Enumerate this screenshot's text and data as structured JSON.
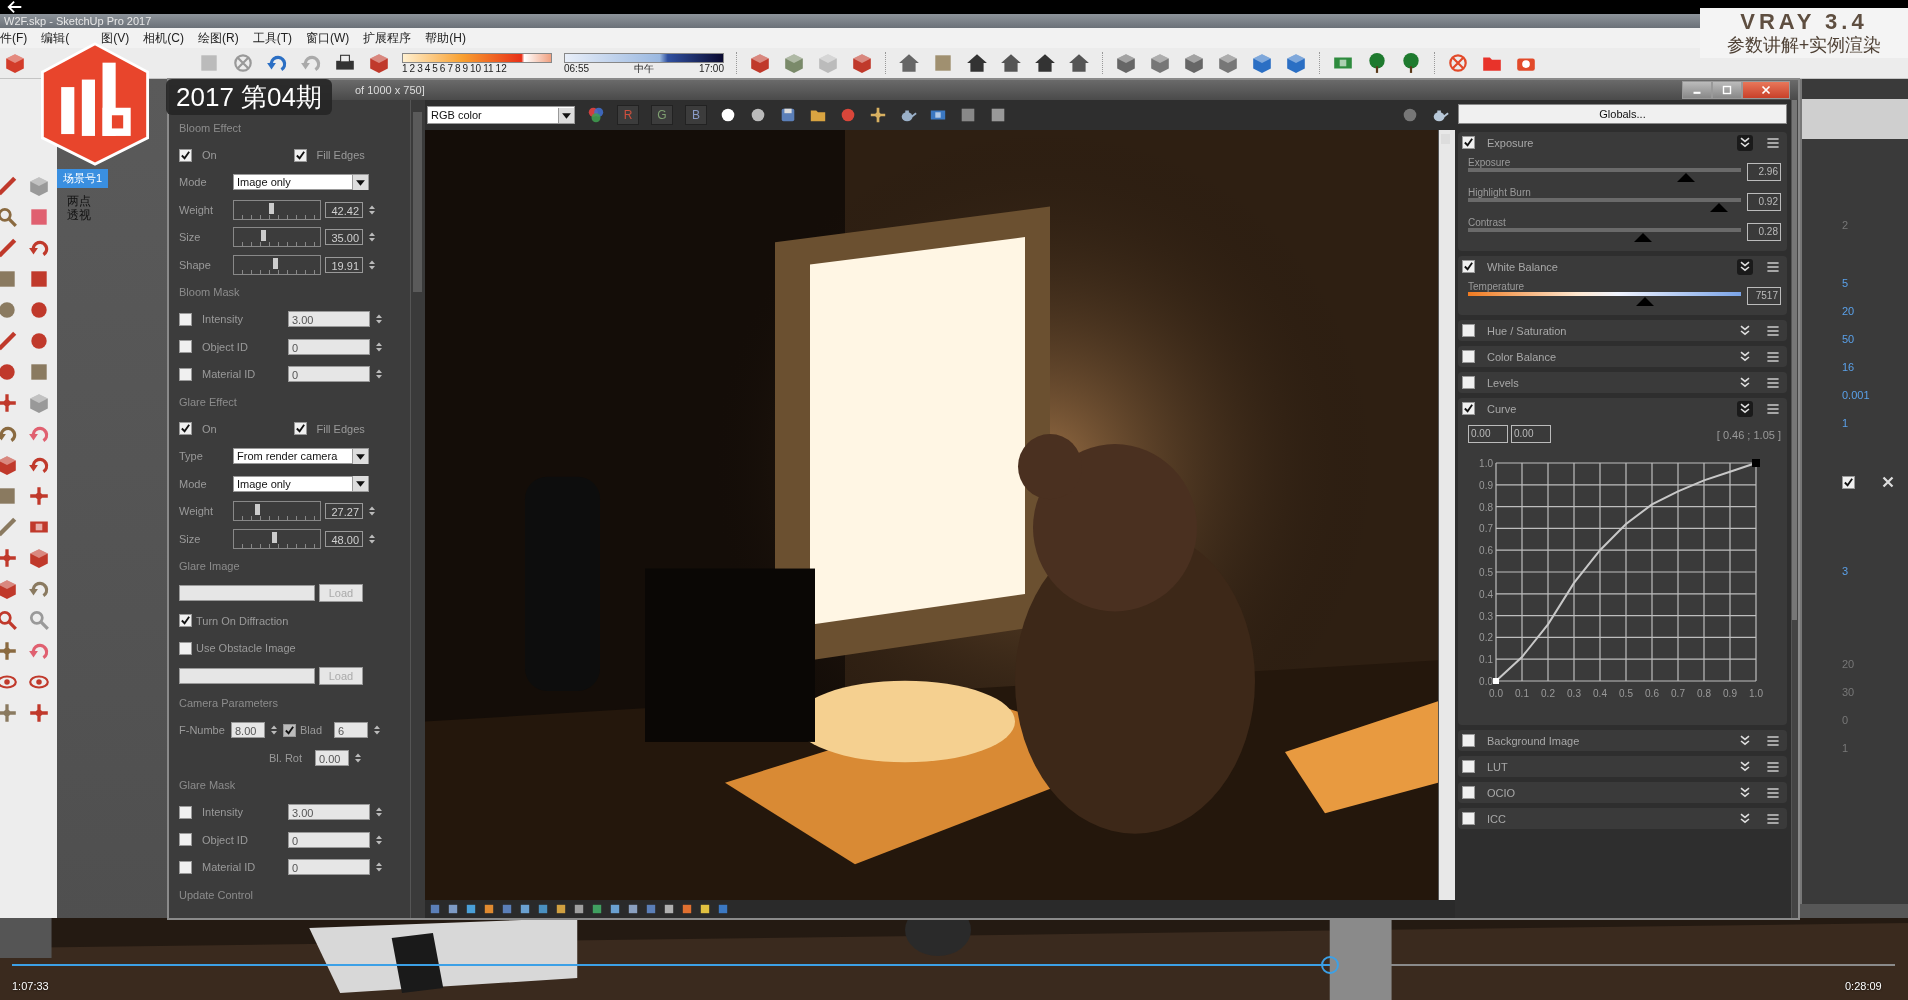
{
  "sketchup": {
    "title": "W2F.skp - SketchUp Pro 2017",
    "menu": [
      "件(F)",
      "编辑(",
      "图(V)",
      "相机(C)",
      "绘图(R)",
      "工具(T)",
      "窗口(W)",
      "扩展程序",
      "帮助(H)"
    ],
    "shadow_months": [
      "1",
      "2",
      "3",
      "4",
      "5",
      "6",
      "7",
      "8",
      "9",
      "10",
      "11",
      "12"
    ],
    "shadow_times": [
      "06:55",
      "中午",
      "17:00"
    ],
    "scene_tab": {
      "label": "场景号1",
      "selected": true
    },
    "viewport_label": "两点透视",
    "tray_groups": [
      [
        {
          "kind": "number",
          "value": "2",
          "disabled": true
        }
      ],
      [
        {
          "kind": "number",
          "value": "5",
          "disabled": false
        },
        {
          "kind": "number",
          "value": "20",
          "disabled": false
        },
        {
          "kind": "number",
          "value": "50",
          "disabled": false
        },
        {
          "kind": "number",
          "value": "16",
          "disabled": false
        },
        {
          "kind": "number",
          "value": "0.001",
          "disabled": false
        },
        {
          "kind": "number",
          "value": "1",
          "disabled": false
        }
      ],
      [
        {
          "kind": "checkbox",
          "checked": true
        }
      ],
      [
        {
          "kind": "number",
          "value": "3",
          "disabled": false
        }
      ],
      [
        {
          "kind": "number",
          "value": "20",
          "disabled": true
        },
        {
          "kind": "number",
          "value": "30",
          "disabled": true
        },
        {
          "kind": "number",
          "value": "0",
          "disabled": true
        },
        {
          "kind": "number",
          "value": "1",
          "disabled": true
        }
      ]
    ]
  },
  "overlays": {
    "badge": "2017 第04期",
    "channel_title": "VRAY 3.4",
    "channel_subtitle": "参数讲解+实例渲染"
  },
  "vfb": {
    "title": "of 1000 x 750]",
    "channel_dropdown": "RGB color",
    "channels": [
      {
        "label": "R",
        "color": "#d0503e",
        "selected": false
      },
      {
        "label": "G",
        "color": "#7fa071",
        "selected": false
      },
      {
        "label": "B",
        "color": "#8a9cc8",
        "selected": false
      }
    ],
    "left_panel": [
      {
        "kind": "header",
        "text": "Bloom Effect"
      },
      {
        "kind": "checks",
        "items": [
          {
            "label": "On",
            "checked": true
          },
          {
            "label": "Fill Edges",
            "checked": true
          }
        ]
      },
      {
        "kind": "dropdown",
        "label": "Mode",
        "value": "Image only"
      },
      {
        "kind": "slider",
        "label": "Weight",
        "level": 0.44,
        "value": "42.42"
      },
      {
        "kind": "slider",
        "label": "Size",
        "level": 0.35,
        "value": "35.00"
      },
      {
        "kind": "slider",
        "label": "Shape",
        "level": 0.49,
        "value": "19.91"
      },
      {
        "kind": "header",
        "text": "Bloom Mask"
      },
      {
        "kind": "check_field",
        "label": "Intensity",
        "checked": false,
        "value": "3.00"
      },
      {
        "kind": "check_field",
        "label": "Object ID",
        "checked": false,
        "value": "0"
      },
      {
        "kind": "check_field",
        "label": "Material ID",
        "checked": false,
        "value": "0"
      },
      {
        "kind": "header",
        "text": "Glare Effect"
      },
      {
        "kind": "checks",
        "items": [
          {
            "label": "On",
            "checked": true
          },
          {
            "label": "Fill Edges",
            "checked": true
          }
        ]
      },
      {
        "kind": "dropdown",
        "label": "Type",
        "value": "From render camera"
      },
      {
        "kind": "dropdown",
        "label": "Mode",
        "value": "Image only"
      },
      {
        "kind": "slider",
        "label": "Weight",
        "level": 0.28,
        "value": "27.27"
      },
      {
        "kind": "slider",
        "label": "Size",
        "level": 0.48,
        "value": "48.00"
      },
      {
        "kind": "header",
        "text": "Glare Image"
      },
      {
        "kind": "file",
        "button": "Load"
      },
      {
        "kind": "check",
        "label": "Turn On Diffraction",
        "checked": true
      },
      {
        "kind": "check",
        "label": "Use Obstacle Image",
        "checked": false
      },
      {
        "kind": "file",
        "button": "Load"
      },
      {
        "kind": "header",
        "text": "Camera Parameters"
      },
      {
        "kind": "camera",
        "label": "F-Numbe",
        "value": "8.00",
        "checked": true,
        "label2": "Blad",
        "value2": "6"
      },
      {
        "kind": "field",
        "label": "Bl. Rot",
        "value": "0.00"
      },
      {
        "kind": "header",
        "text": "Glare Mask"
      },
      {
        "kind": "check_field",
        "label": "Intensity",
        "checked": false,
        "value": "3.00"
      },
      {
        "kind": "check_field",
        "label": "Object ID",
        "checked": false,
        "value": "0"
      },
      {
        "kind": "check_field",
        "label": "Material ID",
        "checked": false,
        "value": "0"
      },
      {
        "kind": "header",
        "text": "Update Control"
      }
    ],
    "globals_button": "Globals...",
    "layers": [
      {
        "title": "Exposure",
        "checked": true,
        "expanded": true,
        "sliders": [
          {
            "kind": "plain",
            "label": "Exposure",
            "level": 0.8,
            "value": "2.96"
          },
          {
            "kind": "plain",
            "label": "Highlight Burn",
            "level": 0.92,
            "value": "0.92"
          },
          {
            "kind": "plain",
            "label": "Contrast",
            "level": 0.64,
            "value": "0.28"
          }
        ]
      },
      {
        "title": "White Balance",
        "checked": true,
        "expanded": true,
        "sliders": [
          {
            "kind": "temperature",
            "label": "Temperature",
            "level": 0.65,
            "value": "7517"
          }
        ]
      },
      {
        "title": "Hue / Saturation",
        "checked": false,
        "expanded": false
      },
      {
        "title": "Color Balance",
        "checked": false,
        "expanded": false
      },
      {
        "title": "Levels",
        "checked": false,
        "expanded": false
      },
      {
        "title": "Curve",
        "checked": true,
        "expanded": true,
        "curve": {
          "fields": [
            "0.00",
            "0.00"
          ],
          "readout": "[ 0.46 ; 1.05 ]",
          "chart_data": {
            "type": "line",
            "x": [
              0,
              0.1,
              0.2,
              0.3,
              0.4,
              0.5,
              0.6,
              0.7,
              0.8,
              0.9,
              1.0
            ],
            "grid": true,
            "series": [
              {
                "color": "#c8c8c8",
                "values": [
                  0,
                  0.11,
                  0.26,
                  0.45,
                  0.6,
                  0.72,
                  0.81,
                  0.87,
                  0.92,
                  0.96,
                  1.0
                ]
              }
            ],
            "xlim": [
              0,
              1
            ],
            "ylim": [
              0,
              1
            ],
            "xticks": [
              {
                "value": 0,
                "label": "0.0"
              },
              {
                "value": 0.1,
                "label": "0.1"
              },
              {
                "value": 0.2,
                "label": "0.2"
              },
              {
                "value": 0.3,
                "label": "0.3"
              },
              {
                "value": 0.4,
                "label": "0.4"
              },
              {
                "value": 0.5,
                "label": "0.5"
              },
              {
                "value": 0.6,
                "label": "0.6"
              },
              {
                "value": 0.7,
                "label": "0.7"
              },
              {
                "value": 0.8,
                "label": "0.8"
              },
              {
                "value": 0.9,
                "label": "0.9"
              },
              {
                "value": 1,
                "label": "1.0"
              }
            ],
            "yticks": [
              {
                "value": 0,
                "label": "0.0"
              },
              {
                "value": 0.1,
                "label": "0.1"
              },
              {
                "value": 0.2,
                "label": "0.2"
              },
              {
                "value": 0.3,
                "label": "0.3"
              },
              {
                "value": 0.4,
                "label": "0.4"
              },
              {
                "value": 0.5,
                "label": "0.5"
              },
              {
                "value": 0.6,
                "label": "0.6"
              },
              {
                "value": 0.7,
                "label": "0.7"
              },
              {
                "value": 0.8,
                "label": "0.8"
              },
              {
                "value": 0.9,
                "label": "0.9"
              },
              {
                "value": 1,
                "label": "1.0"
              }
            ]
          }
        }
      },
      {
        "title": "Background Image",
        "checked": false,
        "expanded": false
      },
      {
        "title": "LUT",
        "checked": false,
        "expanded": false
      },
      {
        "title": "OCIO",
        "checked": false,
        "expanded": false
      },
      {
        "title": "ICC",
        "checked": false,
        "expanded": false
      }
    ]
  },
  "player": {
    "elapsed": "1:07:33",
    "end_time": "0:28:09",
    "level": 0.7
  }
}
